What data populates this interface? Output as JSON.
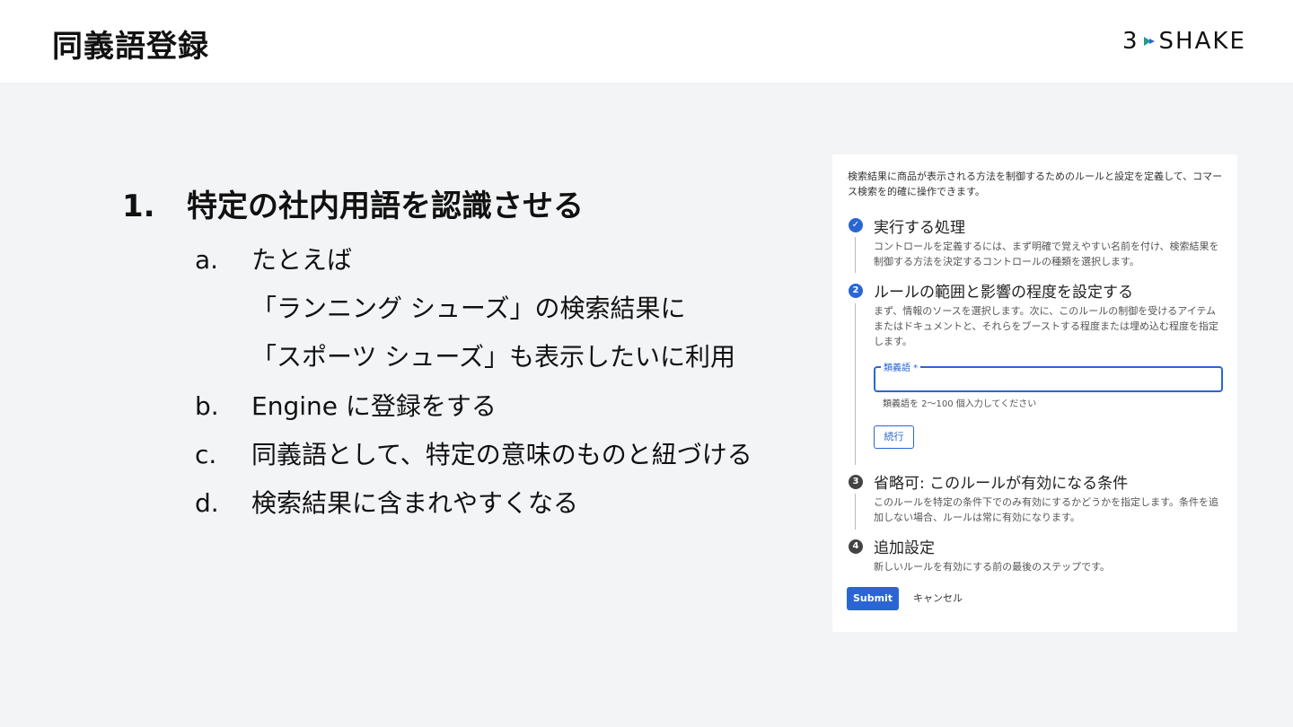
{
  "header": {
    "title": "同義語登録",
    "logo_text_left": "3",
    "logo_text_right": "SHAKE"
  },
  "slide": {
    "heading_number": "1.",
    "heading_text": "特定の社内用語を認識させる",
    "items": [
      {
        "letter": "a.",
        "text": "たとえば"
      },
      {
        "letter": "b.",
        "text": "Engine に登録をする"
      },
      {
        "letter": "c.",
        "text": "同義語として、特定の意味のものと紐づける"
      },
      {
        "letter": "d.",
        "text": "検索結果に含まれやすくなる"
      }
    ],
    "item_a_line2": "「ランニング シューズ」の検索結果に",
    "item_a_line3": "「スポーツ シューズ」も表示したいに利用"
  },
  "panel": {
    "intro": "検索結果に商品が表示される方法を制御するためのルールと設定を定義して、コマース検索を的確に操作できます。",
    "steps": [
      {
        "badge": "✓",
        "title": "実行する処理",
        "desc": "コントロールを定義するには、まず明確で覚えやすい名前を付け、検索結果を制御する方法を決定するコントロールの種類を選択します。"
      },
      {
        "badge": "2",
        "title": "ルールの範囲と影響の程度を設定する",
        "desc": "まず、情報のソースを選択します。次に、このルールの制御を受けるアイテムまたはドキュメントと、それらをブーストする程度または埋め込む程度を指定します。"
      },
      {
        "badge": "3",
        "title": "省略可: このルールが有効になる条件",
        "desc": "このルールを特定の条件下でのみ有効にするかどうかを指定します。条件を追加しない場合、ルールは常に有効になります。"
      },
      {
        "badge": "4",
        "title": "追加設定",
        "desc": "新しいルールを有効にする前の最後のステップです。"
      }
    ],
    "field_label": "類義語 *",
    "field_value": "",
    "field_hint": "類義語を 2〜100 個入力してください",
    "continue_label": "続行",
    "submit_label": "Submit",
    "cancel_label": "キャンセル"
  },
  "colors": {
    "accent": "#2a66d3",
    "background": "#f3f4f6",
    "header_bg": "#ffffff"
  }
}
